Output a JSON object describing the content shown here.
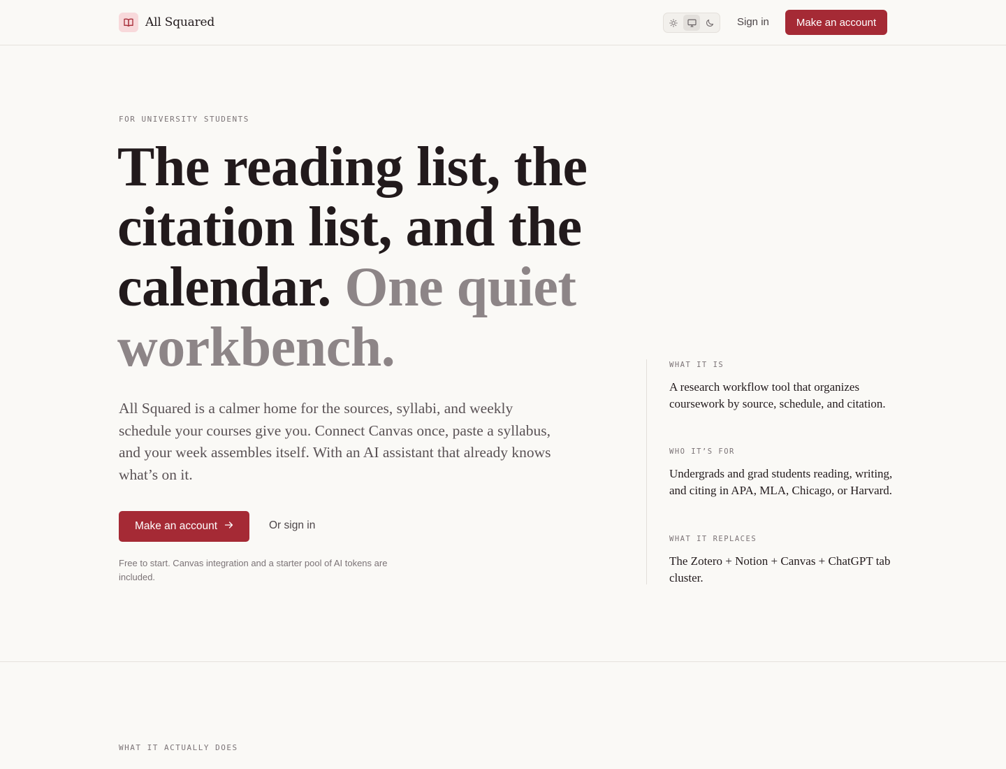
{
  "header": {
    "brand_name": "All Squared",
    "theme_options": [
      "light-icon",
      "system-icon",
      "dark-icon"
    ],
    "theme_selected": "system",
    "signin_label": "Sign in",
    "cta_label": "Make an account"
  },
  "hero": {
    "eyebrow": "FOR UNIVERSITY STUDENTS",
    "headline_main": "The reading list, the citation list, and the calendar.",
    "headline_muted": "One quiet workbench.",
    "lead": "All Squared is a calmer home for the sources, syllabi, and weekly schedule your courses give you. Connect Canvas once, paste a syllabus, and your week assembles itself. With an AI assistant that already knows what’s on it.",
    "cta_label": "Make an account",
    "cta_icon": "arrow-right-icon",
    "signin_label": "Or sign in",
    "fineprint": "Free to start. Canvas integration and a starter pool of AI tokens are included."
  },
  "aside": {
    "blocks": [
      {
        "label": "WHAT IT IS",
        "text": "A research workflow tool that organizes coursework by source, schedule, and citation."
      },
      {
        "label": "WHO IT’S FOR",
        "text": "Undergrads and grad students reading, writing, and citing in APA, MLA, Chicago, or Harvard."
      },
      {
        "label": "WHAT IT REPLACES",
        "text": "The Zotero + Notion + Canvas + ChatGPT tab cluster."
      }
    ]
  },
  "next_section": {
    "eyebrow": "WHAT IT ACTUALLY DOES"
  },
  "colors": {
    "accent": "#a52a35",
    "background": "#faf9f6",
    "brand_mark_bg": "#f8d9db"
  }
}
